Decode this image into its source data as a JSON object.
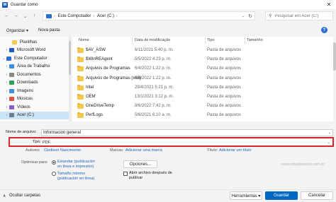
{
  "window": {
    "title": "Guardar como",
    "app_icon_letter": "W",
    "close_glyph": "✕"
  },
  "nav": {
    "back": "←",
    "forward": "→",
    "up_menu": "⌄",
    "up": "↑"
  },
  "address": {
    "segments": [
      "Este Computador",
      "Acer (C:)"
    ],
    "separator": "›"
  },
  "search": {
    "placeholder": "Pesquisar em Acer (C:)"
  },
  "toolbar": {
    "organize": "Organizar ▾",
    "new_folder": "Nova pasta",
    "help": "?"
  },
  "sidebar": {
    "items": [
      {
        "label": "Planilhas",
        "icon_color": "#f2c94c",
        "indent": 2
      },
      {
        "label": "Microsoft Word",
        "icon_color": "#185abd",
        "indent": 1,
        "chevron": "›"
      },
      {
        "label": "Este Computador",
        "icon_color": "#2b6fd1",
        "indent": 0,
        "chevron": "⌄"
      },
      {
        "label": "Área de Trabalho",
        "icon_color": "#3a8ee6",
        "indent": 1,
        "chevron": "›"
      },
      {
        "label": "Documentos",
        "icon_color": "#8a8a8a",
        "indent": 1,
        "chevron": "›"
      },
      {
        "label": "Downloads",
        "icon_color": "#2f9e5a",
        "indent": 1,
        "chevron": "›"
      },
      {
        "label": "Imagens",
        "icon_color": "#3a8ee6",
        "indent": 1,
        "chevron": "›"
      },
      {
        "label": "Músicas",
        "icon_color": "#e0533d",
        "indent": 1,
        "chevron": "›"
      },
      {
        "label": "Vídeos",
        "icon_color": "#8a5cd1",
        "indent": 1,
        "chevron": "›"
      },
      {
        "label": "Acer (C:)",
        "icon_color": "#6d7b8a",
        "indent": 1,
        "chevron": "›",
        "selected": true
      }
    ]
  },
  "columns": {
    "name": "Nome",
    "date": "Data de modificação",
    "type": "Tipo",
    "size": "Tamanho"
  },
  "files": [
    {
      "name": "$AV_ASW",
      "date": "6/11/2021 5:40 p. m.",
      "type": "Pasta de arquivos"
    },
    {
      "name": "$WinREAgent",
      "date": "5/5/2022 4:23 p. m.",
      "type": "Pasta de arquivos"
    },
    {
      "name": "Arquivos de Programas",
      "date": "6/4/2022 1:22 p. m.",
      "type": "Pasta de arquivos"
    },
    {
      "name": "Arquivos de Programas (x86)",
      "date": "6/4/2022 1:22 p. m.",
      "type": "Pasta de arquivos"
    },
    {
      "name": "Intel",
      "date": "29/4/2021 5:21 p. m.",
      "type": "Pasta de arquivos"
    },
    {
      "name": "OEM",
      "date": "13/1/2021 3:12 p. m.",
      "type": "Pasta de arquivos"
    },
    {
      "name": "OneDriveTemp",
      "date": "8/6/2022 7:42 p. m.",
      "type": "Pasta de arquivos"
    },
    {
      "name": "PerfLogs",
      "date": "5/6/2021 6:10 a. m.",
      "type": "Pasta de arquivos"
    }
  ],
  "form": {
    "filename_label": "Nome de arquivo:",
    "filename_value": "Informacion general",
    "type_label": "Tipo:",
    "type_value": "PDF",
    "authors_label": "Autores:",
    "authors_value": "Cledison Nascimento",
    "tags_label": "Marcas:",
    "tags_value": "Adicionar uma marca",
    "title_label": "Título:",
    "title_value": "Adicionar um título",
    "optimize_label": "Optimizar para:",
    "opt_standard_line1": "Estandar (publicación",
    "opt_standard_line2": "en línea e impresión)",
    "opt_min_line1": "Tamaño mínimo",
    "opt_min_line2": "(publicación en línea)",
    "options_button": "Opciones...",
    "open_after_line1": "Abrir archivo después de",
    "open_after_line2": "publicar",
    "watermark": "www.ninjadoexcel.com.br",
    "dropdown_glyph": "⌄"
  },
  "bottom": {
    "hide_folders": "Ocultar carpetas",
    "hide_glyph": "∧",
    "tools": "Herramientas ▾",
    "save": "Guardar",
    "cancel": "Cancelar"
  }
}
